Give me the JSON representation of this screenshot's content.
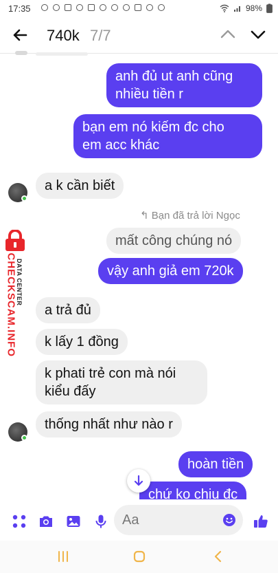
{
  "status_bar": {
    "time": "17:35",
    "battery": "98%"
  },
  "header": {
    "search_term": "740k",
    "result_counter": "7/7"
  },
  "messages": [
    {
      "direction": "outgoing",
      "lines": [
        "anh đủ ut anh cũng",
        "nhiều tiền r"
      ]
    },
    {
      "direction": "outgoing",
      "lines": [
        "bạn em nó kiếm đc cho",
        "em acc khác"
      ]
    },
    {
      "direction": "incoming",
      "lines": [
        "a k cần biết"
      ]
    },
    {
      "direction": "reply-note",
      "lines": [
        "Bạn đã trả lời Ngọc"
      ]
    },
    {
      "direction": "quoted",
      "lines": [
        "mất công chúng nó"
      ]
    },
    {
      "direction": "outgoing",
      "lines": [
        "vậy anh giả em 720k"
      ]
    },
    {
      "direction": "incoming",
      "lines": [
        "a trả đủ"
      ]
    },
    {
      "direction": "incoming",
      "lines": [
        "k lấy 1 đồng"
      ]
    },
    {
      "direction": "incoming",
      "lines": [
        "k phati trẻ con mà nói",
        "kiểu đấy"
      ]
    },
    {
      "direction": "incoming",
      "lines": [
        "thống nhất như nào r"
      ]
    },
    {
      "direction": "outgoing",
      "lines": [
        "hoàn tiền"
      ]
    },
    {
      "direction": "outgoing",
      "lines": [
        "chứ ko chịu đc"
      ]
    }
  ],
  "watermark": {
    "brand": "CHECKSCAM.INFO",
    "sub": "DATA CENTER"
  },
  "composer": {
    "placeholder": "Aa"
  },
  "colors": {
    "outgoing_bubble": "#5a3ff0",
    "incoming_bubble": "#efefef",
    "accent": "#5a3ff0",
    "online": "#43c14a",
    "watermark_red": "#e8262b"
  }
}
